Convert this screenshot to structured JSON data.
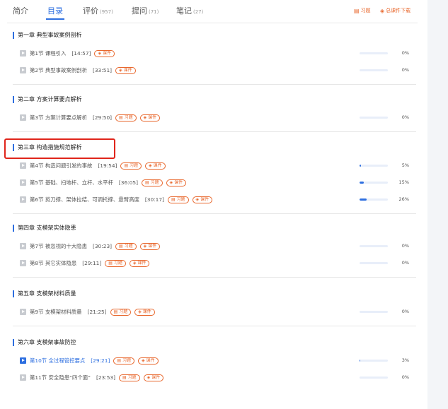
{
  "tabs": [
    {
      "label": "简介",
      "count": ""
    },
    {
      "label": "目录",
      "count": ""
    },
    {
      "label": "评价",
      "count": "(957)"
    },
    {
      "label": "提问",
      "count": "(71)"
    },
    {
      "label": "笔记",
      "count": "(27)"
    }
  ],
  "active_tab": "目录",
  "toplinks": {
    "exercise": "习题",
    "download": "总课件下载"
  },
  "tag_labels": {
    "exercise": "习题",
    "courseware": "课件"
  },
  "colors": {
    "accent": "#2e6fe0",
    "orange": "#e8672c",
    "highlight": "#e0251b"
  },
  "chapters": [
    {
      "title": "第一章 典型事故案例剖析",
      "lessons": [
        {
          "title": "第1节 课程引入",
          "duration": "[14:57]",
          "exercise": false,
          "courseware": true,
          "progress": 0,
          "pct": "0%"
        },
        {
          "title": "第2节 典型事故案例剖析",
          "duration": "[33:51]",
          "exercise": false,
          "courseware": true,
          "progress": 0,
          "pct": "0%"
        }
      ]
    },
    {
      "title": "第二章 方案计算要点解析",
      "lessons": [
        {
          "title": "第3节 方案计算要点解析",
          "duration": "[29:50]",
          "exercise": true,
          "courseware": true,
          "progress": 0,
          "pct": "0%"
        }
      ]
    },
    {
      "title": "第三章 构造措施规范解析",
      "lessons": [
        {
          "title": "第4节 构造问题引发的事故",
          "duration": "[19:54]",
          "exercise": true,
          "courseware": true,
          "progress": 5,
          "pct": "5%"
        },
        {
          "title": "第5节 基础、扫地杆、立杆、水平杆",
          "duration": "[36:05]",
          "exercise": true,
          "courseware": true,
          "progress": 15,
          "pct": "15%"
        },
        {
          "title": "第6节 剪刀撑、架体拉结、可调托撑、悬臂高度",
          "duration": "[30:17]",
          "exercise": true,
          "courseware": true,
          "progress": 26,
          "pct": "26%"
        }
      ]
    },
    {
      "title": "第四章 支模架实体隐患",
      "lessons": [
        {
          "title": "第7节 被忽视的十大隐患",
          "duration": "[30:23]",
          "exercise": true,
          "courseware": true,
          "progress": 0,
          "pct": "0%"
        },
        {
          "title": "第8节 其它实体隐患",
          "duration": "[29:11]",
          "exercise": true,
          "courseware": true,
          "progress": 0,
          "pct": "0%"
        }
      ]
    },
    {
      "title": "第五章 支模架材料质量",
      "lessons": [
        {
          "title": "第9节 支模架材料质量",
          "duration": "[21:25]",
          "exercise": true,
          "courseware": true,
          "progress": 0,
          "pct": "0%"
        }
      ]
    },
    {
      "title": "第六章 支模架事故防控",
      "lessons": [
        {
          "title": "第10节 全过程管控要点",
          "duration": "[29:21]",
          "exercise": true,
          "courseware": true,
          "progress": 3,
          "pct": "3%",
          "current": true
        },
        {
          "title": "第11节 安全隐患“四个面”",
          "duration": "[23:53]",
          "exercise": true,
          "courseware": true,
          "progress": 0,
          "pct": "0%"
        }
      ]
    }
  ]
}
